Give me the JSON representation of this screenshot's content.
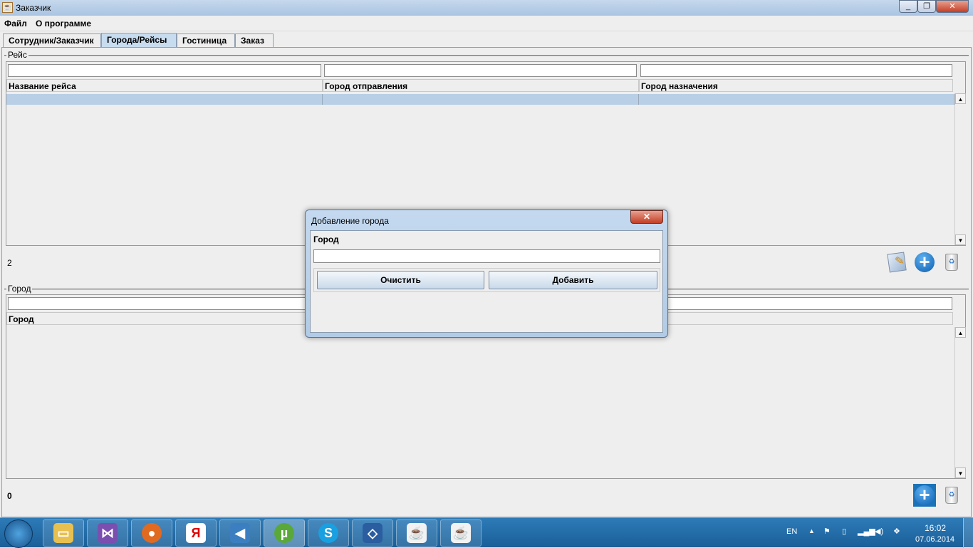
{
  "window": {
    "title": "Заказчик",
    "min": "_",
    "max": "❐",
    "close": "✕"
  },
  "menu": [
    "Файл",
    "О программе"
  ],
  "tabs": [
    "Сотрудник/Заказчик",
    "Города/Рейсы",
    "Гостиница",
    "Заказ"
  ],
  "flights": {
    "legend": "Рейс",
    "columns": [
      "Название рейса",
      "Город отправления",
      "Город назначения"
    ],
    "count": "2"
  },
  "cities": {
    "legend": "Город",
    "columns": [
      "Город"
    ],
    "count": "0"
  },
  "dialog": {
    "title": "Добавление города",
    "close": "✕",
    "label": "Город",
    "value": "",
    "clear": "Очистить",
    "add": "Добавить"
  },
  "taskbar": {
    "lang": "EN",
    "time": "16:02",
    "date": "07.06.2014",
    "apps": [
      "explorer",
      "visual-studio",
      "firefox",
      "yandex",
      "audio",
      "utorrent",
      "skype",
      "virtualbox",
      "java",
      "java"
    ]
  }
}
